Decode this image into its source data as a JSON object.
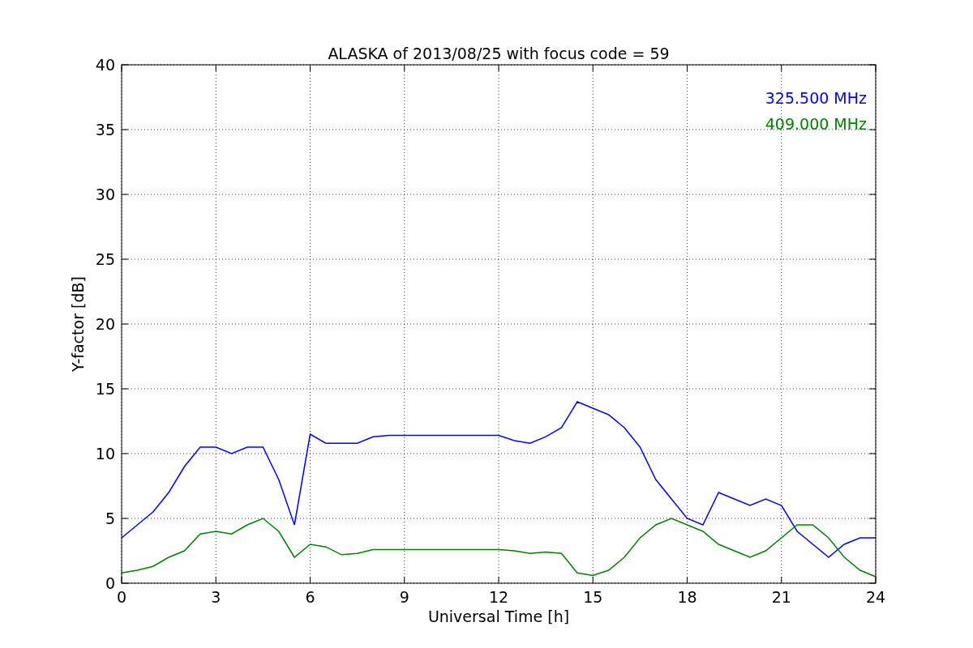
{
  "chart_data": {
    "type": "line",
    "title": "ALASKA of 2013/08/25 with focus code = 59",
    "xlabel": "Universal Time [h]",
    "ylabel": "Y-factor [dB]",
    "x": [
      0,
      0.5,
      1,
      1.5,
      2,
      2.5,
      3,
      3.5,
      4,
      4.5,
      5,
      5.5,
      6,
      6.5,
      7,
      7.5,
      8,
      8.5,
      9,
      9.5,
      10,
      10.5,
      11,
      11.5,
      12,
      12.5,
      13,
      13.5,
      14,
      14.5,
      15,
      15.5,
      16,
      16.5,
      17,
      17.5,
      18,
      18.5,
      19,
      19.5,
      20,
      20.5,
      21,
      21.5,
      22,
      22.5,
      23,
      23.5,
      24
    ],
    "series": [
      {
        "name": "325.500 MHz",
        "color": "#0000ff",
        "values": [
          3.5,
          4.5,
          5.5,
          7,
          9,
          10.5,
          10.5,
          10,
          10.5,
          10.5,
          8,
          4.5,
          11.5,
          10.8,
          10.8,
          10.8,
          11.3,
          11.4,
          11.4,
          11.4,
          11.4,
          11.4,
          11.4,
          11.4,
          11.4,
          11,
          10.8,
          11.3,
          12,
          14,
          13.5,
          13,
          12,
          10.5,
          8,
          6.5,
          5,
          4.5,
          7,
          6.5,
          6,
          6.5,
          6,
          4,
          3,
          2,
          3,
          3.5,
          3.5
        ]
      },
      {
        "name": "409.000 MHz",
        "color": "#008000",
        "values": [
          0.8,
          1,
          1.3,
          2,
          2.5,
          3.8,
          4,
          3.8,
          4.5,
          5,
          4,
          2,
          3,
          2.8,
          2.2,
          2.3,
          2.6,
          2.6,
          2.6,
          2.6,
          2.6,
          2.6,
          2.6,
          2.6,
          2.6,
          2.5,
          2.3,
          2.4,
          2.3,
          0.8,
          0.6,
          1,
          2,
          3.5,
          4.5,
          5,
          4.5,
          4,
          3,
          2.5,
          2,
          2.5,
          3.5,
          4.5,
          4.5,
          3.5,
          2,
          1,
          0.5
        ]
      }
    ],
    "grid": true,
    "xlim": [
      0,
      24
    ],
    "ylim": [
      0,
      40
    ],
    "xticks": [
      0,
      3,
      6,
      9,
      12,
      15,
      18,
      21,
      24
    ],
    "yticks": [
      0,
      5,
      10,
      15,
      20,
      25,
      30,
      35,
      40
    ]
  }
}
